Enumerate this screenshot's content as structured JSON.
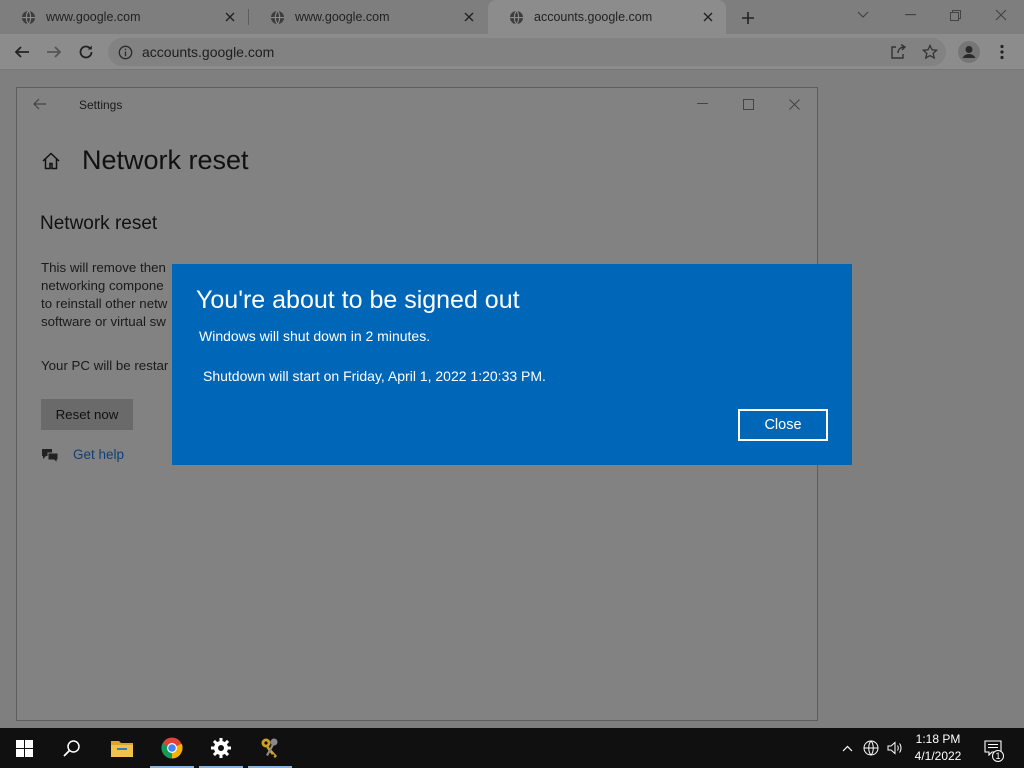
{
  "browser": {
    "tabs": [
      {
        "title": "www.google.com",
        "active": false
      },
      {
        "title": "www.google.com",
        "active": false
      },
      {
        "title": "accounts.google.com",
        "active": true
      }
    ],
    "address": "accounts.google.com"
  },
  "settings": {
    "window_title": "Settings",
    "page_title": "Network reset",
    "section_title": "Network reset",
    "description_lines": [
      "This will remove then",
      "networking compone",
      "to reinstall other netw",
      "software or virtual sw"
    ],
    "restart_note": "Your PC will be restar",
    "reset_button": "Reset now",
    "help_link": "Get help"
  },
  "dialog": {
    "title": "You're about to be signed out",
    "message": "Windows will shut down in 2 minutes.",
    "shutdown_time": "Shutdown will start on Friday, April 1, 2022 1:20:33 PM.",
    "close_button": "Close",
    "color": "#0067b8"
  },
  "taskbar": {
    "time": "1:18 PM",
    "date": "4/1/2022",
    "notification_count": "1",
    "pinned": [
      "start-icon",
      "search-icon",
      "file-explorer-icon",
      "chrome-icon",
      "settings-gear-icon",
      "keys-app-icon"
    ]
  }
}
